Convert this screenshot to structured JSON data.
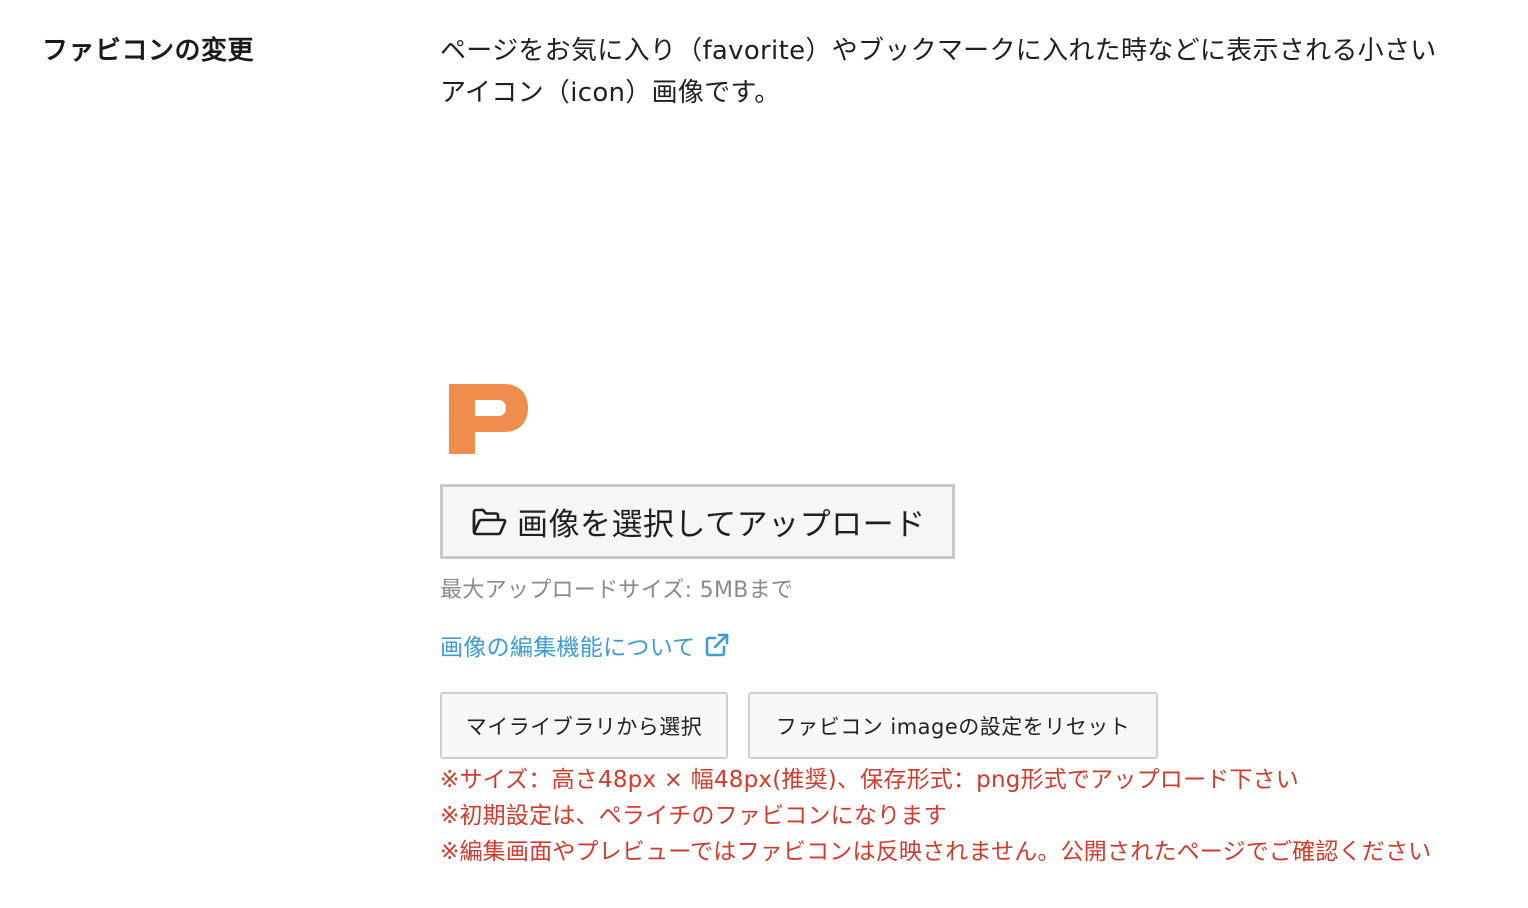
{
  "setting": {
    "label": "ファビコンの変更",
    "description_line1": "ページをお気に入り（favorite）やブックマークに入れた時などに表示される小さい",
    "description_line2": "アイコン（icon）画像です。"
  },
  "preview": {
    "icon": "favicon-p-icon",
    "letter": "P",
    "color": "#ef8d4c"
  },
  "upload": {
    "button_label": "画像を選択してアップロード",
    "icon": "folder-open-icon",
    "max_size_text": "最大アップロードサイズ: 5MBまで"
  },
  "edit_link": {
    "text": "画像の編集機能について",
    "icon": "external-link-icon"
  },
  "actions": {
    "library_label": "マイライブラリから選択",
    "reset_label": "ファビコン imageの設定をリセット"
  },
  "notes": [
    "※サイズ：高さ48px × 幅48px(推奨)、保存形式：png形式でアップロード下さい",
    "※初期設定は、ペライチのファビコンになります",
    "※編集画面やプレビューではファビコンは反映されません。公開されたページでご確認ください"
  ],
  "colors": {
    "note_red": "#d23b2c",
    "link_blue": "#3d9bd6",
    "muted_gray": "#8a8a8a"
  }
}
